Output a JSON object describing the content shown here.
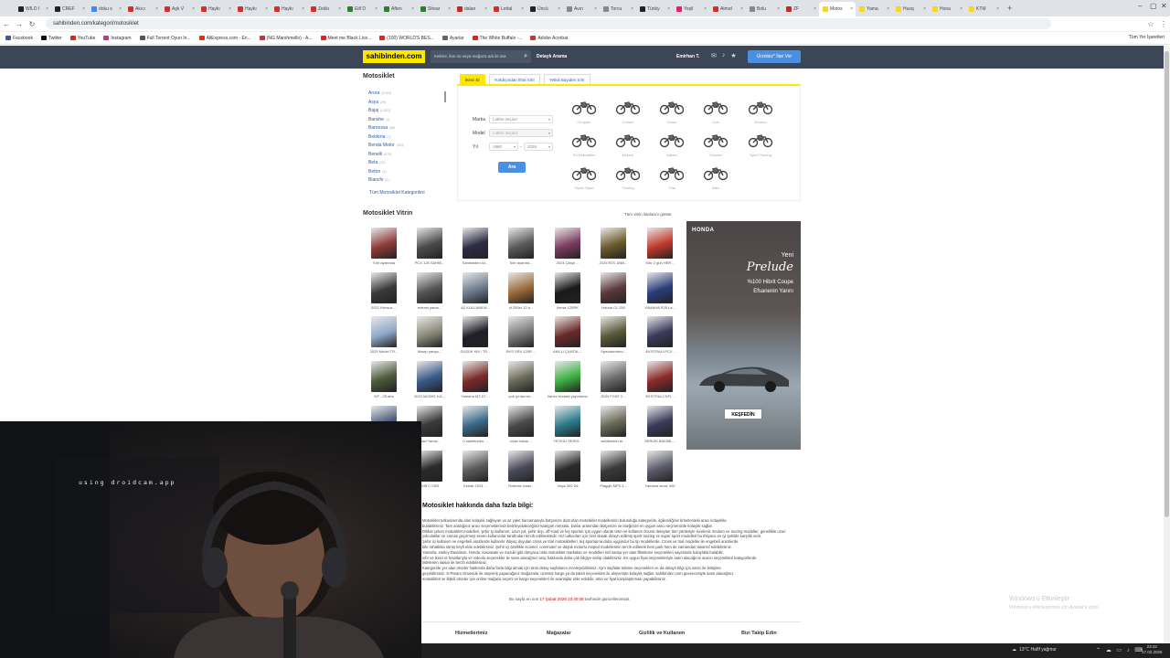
{
  "browser": {
    "tabs": [
      {
        "title": "WILD I",
        "color": "#222222"
      },
      {
        "title": "CREF",
        "color": "#222222"
      },
      {
        "title": "doku s",
        "color": "#4285f4"
      },
      {
        "title": "Akıcı",
        "color": "#d32f2f"
      },
      {
        "title": "Aşk V",
        "color": "#d32f2f"
      },
      {
        "title": "Haykı",
        "color": "#d32f2f"
      },
      {
        "title": "Haykı",
        "color": "#d32f2f"
      },
      {
        "title": "Haykı",
        "color": "#d32f2f"
      },
      {
        "title": "Zekkı",
        "color": "#d32f2f"
      },
      {
        "title": "Elif D",
        "color": "#2e7d32"
      },
      {
        "title": "Aften",
        "color": "#2e7d32"
      },
      {
        "title": "Shear",
        "color": "#2e7d32"
      },
      {
        "title": "dalan",
        "color": "#c62828"
      },
      {
        "title": "Lettal",
        "color": "#d32f2f"
      },
      {
        "title": "Üncü",
        "color": "#222222"
      },
      {
        "title": "Avın",
        "color": "#888888"
      },
      {
        "title": "Torcu",
        "color": "#888888"
      },
      {
        "title": "Türkiy",
        "color": "#222222"
      },
      {
        "title": "Yeşil",
        "color": "#e91e63"
      },
      {
        "title": "Almıd",
        "color": "#d32f2f"
      },
      {
        "title": "Bolu",
        "color": "#888888"
      },
      {
        "title": "ZF",
        "color": "#c62828"
      },
      {
        "title": "Motos",
        "color": "#f9d71c",
        "active": true
      },
      {
        "title": "Yama",
        "color": "#f9d71c"
      },
      {
        "title": "Husq",
        "color": "#f9d71c"
      },
      {
        "title": "Hona",
        "color": "#f9d71c"
      },
      {
        "title": "KTM",
        "color": "#f9d71c"
      }
    ],
    "new_tab": "+",
    "url": "sahibinden.com/kategori/motosiklet",
    "bookmarks": [
      {
        "label": "Facebook",
        "color": "#3b5998"
      },
      {
        "label": "Twitter",
        "color": "#111111"
      },
      {
        "label": "YouTube",
        "color": "#e62117"
      },
      {
        "label": "Instagram",
        "color": "#c13584"
      },
      {
        "label": "Full Torrent Oyun In...",
        "color": "#555555"
      },
      {
        "label": "AliExpress.com - En...",
        "color": "#e62e04"
      },
      {
        "label": "(NG Marshmello) - A...",
        "color": "#d32f2f"
      },
      {
        "label": "Meet me Black Lice...",
        "color": "#e62117"
      },
      {
        "label": "(100) WORLD'S BES...",
        "color": "#e62117"
      },
      {
        "label": "Ayarlar",
        "color": "#666666"
      },
      {
        "label": "The White Buffalo -...",
        "color": "#e62117"
      },
      {
        "label": "Adobe Acrobat",
        "color": "#d32f2f"
      }
    ],
    "all_bookmarks": "Tüm Yer İşaretleri"
  },
  "header": {
    "logo": "sahibinden.com",
    "search_placeholder": "Kelime, ilan no veya mağaza adı ile ara",
    "detailed_search": "Detaylı Arama",
    "user": "Emirhan T.",
    "post_ad": "Ücretsiz* İlan Ver"
  },
  "sidebar": {
    "title": "Motosiklet",
    "items": [
      {
        "label": "Arora",
        "count": "(3.004)"
      },
      {
        "label": "Asya",
        "count": "(29)"
      },
      {
        "label": "Bajaj",
        "count": "(2.802)"
      },
      {
        "label": "Banshe",
        "count": "(1)"
      },
      {
        "label": "Baroossa",
        "count": "(88)"
      },
      {
        "label": "Belderia",
        "count": "(7)"
      },
      {
        "label": "Benda Motor",
        "count": "(324)"
      },
      {
        "label": "Benelli",
        "count": "(675)"
      },
      {
        "label": "Beta",
        "count": "(22)"
      },
      {
        "label": "Bettor",
        "count": "(4)"
      },
      {
        "label": "Bianchi",
        "count": "(1)"
      }
    ],
    "all_categories": "Tüm Motosiklet Kategorileri"
  },
  "search_panel": {
    "tabs": [
      "İkinci El",
      "Yurtdışından İthal Sıfır",
      "Yetkili Bayiden Sıfır"
    ],
    "brand_label": "Marka",
    "brand_value": "Lütfen seçiniz",
    "model_label": "Model",
    "model_value": "Lütfen seçiniz",
    "year_label": "Yıl",
    "year_from": "1960",
    "year_dash": "-",
    "year_to": "2026",
    "search_button": "Ara",
    "types": [
      "Chopper",
      "Cruiser",
      "Cross",
      "Cub",
      "Enduro",
      "Ez Motosiklet",
      "Moped",
      "Naked",
      "Scooter",
      "Sport Touring",
      "Super Sport",
      "Touring",
      "Trial",
      "Bike"
    ]
  },
  "vitrin": {
    "title": "Motosiklet Vitrin",
    "show_all": "Tüm vitrin ilanlarını göster",
    "items": [
      {
        "caption": "Sıfır ayarında",
        "color": "#8d3b3b"
      },
      {
        "caption": "PCX 125 SAHİB...",
        "color": "#4a4a4a"
      },
      {
        "caption": "Sahibinden öz...",
        "color": "#2c2c44"
      },
      {
        "caption": "Sıfır ayarınd...",
        "color": "#5a5a5a"
      },
      {
        "caption": "2024 Çikişli ...",
        "color": "#7a3b5e"
      },
      {
        "caption": "2025 RJS 1865...",
        "color": "#6b5a2a"
      },
      {
        "caption": "Sıfır 2 gün HER...",
        "color": "#c0392b"
      },
      {
        "caption": "2022 Honsuz ...",
        "color": "#3a3a3a"
      },
      {
        "caption": "extrani yama...",
        "color": "#555555"
      },
      {
        "caption": "AZ KULLANILM...",
        "color": "#6d7b8c"
      },
      {
        "caption": "cf 250sr 12 a...",
        "color": "#9b6b3a"
      },
      {
        "caption": "İlemiz 125RK",
        "color": "#1a1a1a"
      },
      {
        "caption": "Honda CL 250",
        "color": "#5b3a3a"
      },
      {
        "caption": "YAMAHA R25 La...",
        "color": "#2a3d7a"
      },
      {
        "caption": "2025 Model TR...",
        "color": "#8fa8c8"
      },
      {
        "caption": "Mavip yarışa...",
        "color": "#8a8a7a"
      },
      {
        "caption": "DÜŞÜK KM / TR...",
        "color": "#1f1f2a"
      },
      {
        "caption": "RKS SRX 125R ...",
        "color": "#7a7a7a"
      },
      {
        "caption": "AKILLI ÇANTAL...",
        "color": "#6a2a2a"
      },
      {
        "caption": "Specialerdmo...",
        "color": "#5a5a3a"
      },
      {
        "caption": "-EKSTRALI PCX...",
        "color": "#3a3a5a"
      },
      {
        "caption": "MT - 25 abs",
        "color": "#4a5a3a"
      },
      {
        "caption": "2022 MODEL KA...",
        "color": "#3a5a8a"
      },
      {
        "caption": "Yamaha MT-07 ...",
        "color": "#7a2a2a"
      },
      {
        "caption": "çok iyi durum...",
        "color": "#6a6a5a"
      },
      {
        "caption": "İlanım burada yayınlansın",
        "color": "#3cb043"
      },
      {
        "caption": "SON FİYAT !!...",
        "color": "#6a6a6a"
      },
      {
        "caption": "EKSTRALI SIFI...",
        "color": "#8a2a2a"
      },
      {
        "caption": "Alım Satım",
        "color": "#4a5a7a"
      },
      {
        "caption": "Nazi Yama...",
        "color": "#3a3a3a"
      },
      {
        "caption": "0 sahibinden ...",
        "color": "#3a6a8a"
      },
      {
        "caption": "xmax takas ...",
        "color": "#4a4a4a"
      },
      {
        "caption": "YETKİLİ SERVİ...",
        "color": "#2a7a8a"
      },
      {
        "caption": "sahibinden te...",
        "color": "#6a6a5a"
      },
      {
        "caption": "SERVİS BAKIML...",
        "color": "#3a3a5a"
      },
      {
        "caption": "Dafes 2025",
        "color": "#7a5a3a"
      },
      {
        "caption": "Drift C CBS",
        "color": "#2a2a2a"
      },
      {
        "caption": "Estrak 2024 ...",
        "color": "#5a5a5a"
      },
      {
        "caption": "Tertemiz xmax...",
        "color": "#4a4a5a"
      },
      {
        "caption": "Vega 300 Ds",
        "color": "#2a2a2a"
      },
      {
        "caption": "Piaggio MP3 3...",
        "color": "#3a3a3a"
      },
      {
        "caption": "Yamaha xmax 400",
        "color": "#5a5a6a"
      }
    ]
  },
  "ad": {
    "brand": "HONDA",
    "line_new": "Yeni",
    "model": "Prelude",
    "line1": "%100 Hibrit Coupe",
    "line2": "Efsanenin Yarını",
    "button": "KEŞFEDİN"
  },
  "info": {
    "title": "Motosiklet hakkında daha fazla bilgi:",
    "paragraphs": [
      "Motosiklet tutkunlarında alan kolaylık sağlayan ve az yakıt harcamasıyla bütçenize dost olan motosiklet modellerinin bulunduğu kategoride, ilgilendiğiniz kriterlerdeki aracı kolaylıkla",
      "bulabilirsiniz. Tam aradığınız aracı seçeneklerinizi belirleyebileceğiniz kategori menüsü, ilanlar arasından bütçenize ve isteğinize en uygun aracı seçmenizde kolaylık sağlar.",
      "Dikkat çeken motosiklet modelleri, şehir içi kullanım, uzun yol, şehir dışı, off-road ve kış sporları için uygun olarak ürün ve kullanım öncesi detayları tüm yönleriyle incelenir. Enduro ve touring modeller, genellikle uzun",
      "yolculuklar ve zaman geçirmeyi seven kullanıcılar tarafından tercih edilmektedir. Hız tutkunları için özel olarak dizayn edilmiş sport touring ve super sport modelleri bu ihtiyaca en iyi şekilde karşılık verir.",
      "Şehir içi kullanım ve engebeli arazilerde kullanılır ihtiyaç duyulan cross ve trial motosikletleri, kış sporlarına daha uygundur bu tip modellerde. Cross ve trial modeller ile engebeli arazilerde",
      "bile rahatlıkla sürüş keyfi elde edebilirsiniz. Şehir içi özellikle scooter, commuter ve düşük motorlu moped modellerinin tercih edilerek hem park hem de zamandan tasarruf edebilirsiniz.",
      "Yamaha, Harley Davidson, Honda, Kawasaki ve Suzuki gibi dünyaca ünlü motosiklet markaları ve modelleri sizi satışa yer alan filtreleme seçenekleri sayesinde kolaylıkla bulabilir,",
      "sıfır ve ikinci el fırsatlarıyla ve videolu seçenekler ile satın alacağınız araç hakkında daha çok bilgiye sahip olabilirsiniz. En uygun fiyat seçenekleriyle satın alacağınız aracın seçenekleri kategorilerde",
      "listelenen ilanlar ile tercih edebilirsiniz.",
      "Kategoride yer alan ürünler hakkında daha fazla bilgi almak için ürün detay sayfalarını inceleyebilirsiniz. Aynı sayfalar ödeme seçenekleri ve da detaylı bilgi için satıcı ile iletişime",
      "geçebilirsiniz. S-Param Güvende ile alışveriş yapacağınız mağazalar, ücretsiz kargo ya da taksit seçenekleri ile alışverişte kolaylık sağlar. sahibinden.com güvencesiyle satın alacağınız",
      "motosikleti ve ilişkili ürünler için online mağaza seçimi ve kargo seçenekleri ile avantajlar elde edebilir, ürün ve fiyat karşılaştırması yapabilirsiniz."
    ]
  },
  "updated": {
    "prefix": "Bu sayfa en son",
    "date": "17 Şubat 2026 23:40:08",
    "suffix": "tarihinde güncellenmiştir."
  },
  "footer": [
    "Hizmetlerimiz",
    "Mağazalar",
    "Gizlilik ve Kullanım",
    "Bizi Takip Edin"
  ],
  "webcam": {
    "overlay": "using droidcam.app"
  },
  "windows": {
    "activate_title": "Windows'u Etkinleştir",
    "activate_sub": "Windows'u etkinleştirmek için Ayarlar'a gidin.",
    "weather": "13°C Hafif yağmur",
    "time": "23:42",
    "date": "17.02.2026"
  }
}
